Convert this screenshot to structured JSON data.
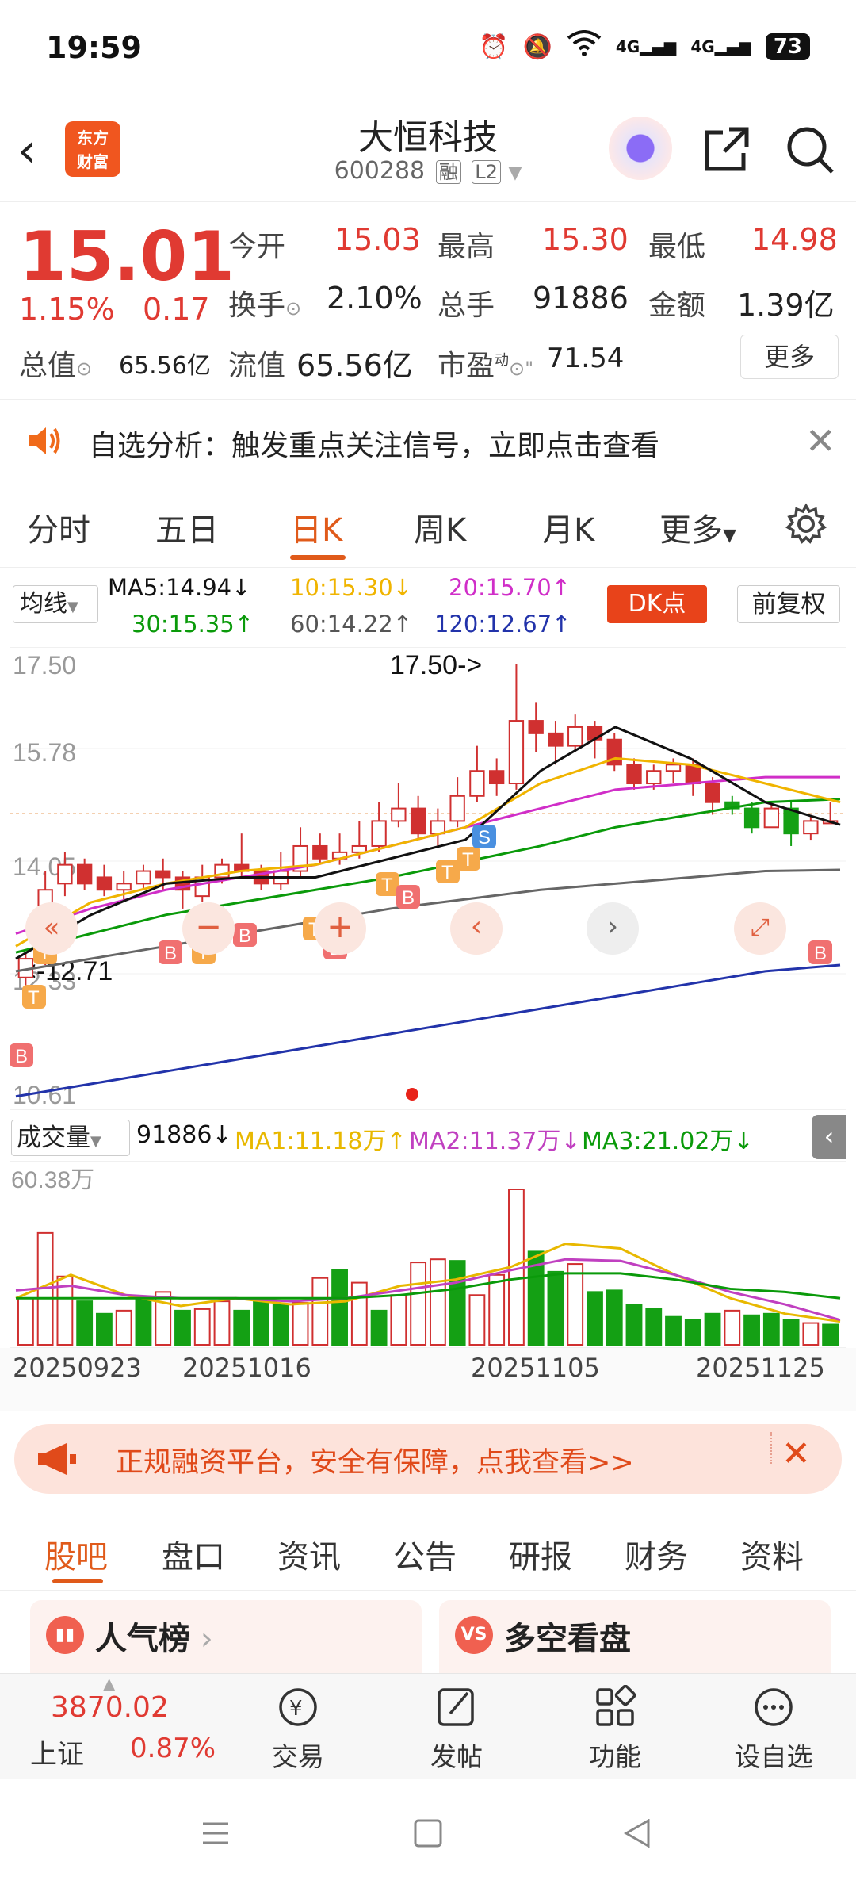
{
  "status_bar": {
    "time": "19:59",
    "net1": "4G",
    "net2": "4G",
    "battery": "73"
  },
  "header": {
    "back_icon": "back-chevron-icon",
    "logo_text": "东方\n财富",
    "stock_name": "大恒科技",
    "stock_code": "600288",
    "tag_rong": "融",
    "tag_l2": "L2"
  },
  "quote": {
    "price": "15.01",
    "change_pct": "1.15%",
    "change_amt": "0.17",
    "open_label": "今开",
    "open_value": "15.03",
    "high_label": "最高",
    "high_value": "15.30",
    "low_label": "最低",
    "low_value": "14.98",
    "turnover_label": "换手",
    "turnover_value": "2.10%",
    "volume_label": "总手",
    "volume_value": "91886",
    "amount_label": "金额",
    "amount_value": "1.39亿",
    "total_cap_label": "总值",
    "total_cap_value": "65.56亿",
    "float_cap_label": "流值",
    "float_cap_value": "65.56亿",
    "pe_label": "市盈",
    "pe_sup": "动",
    "pe_value": "71.54",
    "more_label": "更多"
  },
  "notice": {
    "text": "自选分析：触发重点关注信号，立即点击查看"
  },
  "chart_tabs": [
    "分时",
    "五日",
    "日K",
    "周K",
    "月K",
    "更多"
  ],
  "active_tab": "日K",
  "ma": {
    "selector": "均线",
    "ma5": "MA5:14.94↓",
    "ma10": "10:15.30↓",
    "ma20": "20:15.70↑",
    "ma30": "30:15.35↑",
    "ma60": "60:14.22↑",
    "ma120": "120:12.67↑",
    "dk_label": "DK点",
    "fq_label": "前复权",
    "colors": {
      "ma5": "#111111",
      "ma10": "#f0b400",
      "ma20": "#d02ec8",
      "ma30": "#0a9a0a",
      "ma60": "#666666",
      "ma120": "#2233aa"
    }
  },
  "kline": {
    "y_labels": [
      "17.50",
      "15.78",
      "14.05",
      "12.33",
      "10.61"
    ],
    "high_marker": "17.50->",
    "low_marker": "<-12.71"
  },
  "volume": {
    "selector": "成交量",
    "value": "91886↓",
    "ma1": "MA1:11.18万↑",
    "ma2": "MA2:11.37万↓",
    "ma3": "MA3:21.02万↓",
    "y_label": "60.38万"
  },
  "dates": [
    "20250923",
    "20251016",
    "20251105",
    "20251125"
  ],
  "promo": {
    "text": "正规融资平台，安全有保障，点我查看>>"
  },
  "bottom_tabs": [
    "股吧",
    "盘口",
    "资讯",
    "公告",
    "研报",
    "财务",
    "资料"
  ],
  "active_bottom_tab": "股吧",
  "cards": {
    "left": "人气榜",
    "right": "多空看盘"
  },
  "bottom_nav": {
    "index_value": "3870.02",
    "index_name": "上证",
    "index_pct": "0.87%",
    "trade": "交易",
    "post": "发帖",
    "func": "功能",
    "watch": "设自选"
  }
}
